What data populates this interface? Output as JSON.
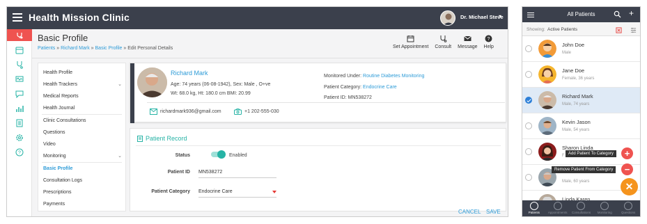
{
  "app": {
    "title": "Health Mission Clinic",
    "doctor": "Dr. Michael Steve"
  },
  "page": {
    "title": "Basic Profile"
  },
  "breadcrumb": [
    "Patients",
    "Richard Mark",
    "Basic Profile",
    "Edit Personal Details"
  ],
  "toolbar": {
    "set_appointment": "Set Appointment",
    "consult": "Consult",
    "message": "Message",
    "help": "Help"
  },
  "menu": {
    "group1": [
      "Health Profile",
      "Health Trackers",
      "Medical Reports",
      "Health Journal"
    ],
    "group2": [
      "Clinic Consultations",
      "Questions",
      "Video",
      "Monitoring"
    ],
    "group3": [
      "Basic Profile",
      "Consultation Logs",
      "Prescriptions",
      "Payments"
    ]
  },
  "patient": {
    "name": "Richard Mark",
    "line1": "Age: 74 years (06-08-1942), Sex: Male , O+ve",
    "line2": "Wt: 68.0 kg, Ht: 180.0 cm BMI: 20.99",
    "monitored_label": "Monitored Under:",
    "monitored_value": "Routine Diabetes Monitoring",
    "category_label": "Patient Category:",
    "category_value": "Endocrine Care",
    "id_label": "Patient ID:",
    "id_value": "MN538272",
    "email": "richardmark936@gmail.com",
    "phone": "+1 202-555-030"
  },
  "record": {
    "title": "Patient Record",
    "status_label": "Status",
    "status_value": "Enabled",
    "status_on": true,
    "id_label": "Patient ID",
    "id_value": "MN538272",
    "category_label": "Patient Category",
    "category_value": "Endocrine Care",
    "cancel": "CANCEL",
    "save": "SAVE"
  },
  "mobile": {
    "title": "All Patients",
    "showing_label": "Showing:",
    "showing_value": "Active Patients",
    "cancel_label": "Cancel",
    "filter_label": "Filter",
    "patients": [
      {
        "name": "John Doe",
        "sub": "Male"
      },
      {
        "name": "Jane Doe",
        "sub": "Female, 36 years"
      },
      {
        "name": "Richard Mark",
        "sub": "Male, 74 years"
      },
      {
        "name": "Kevin Jason",
        "sub": "Male, 54 years"
      },
      {
        "name": "Sharon Linda",
        "sub": "F"
      },
      {
        "name": "",
        "sub": "Male, 60 years"
      },
      {
        "name": "Linda Karen",
        "sub": ""
      }
    ],
    "tip_add": "Add Patient To Category",
    "tip_remove": "Remove Patient From Category",
    "bottom_nav": [
      "Patients",
      "Appointments",
      "Consultations",
      "Monitoring",
      "Questions"
    ]
  },
  "colors": {
    "header": "#3b404c",
    "accent": "#2d9bd7",
    "teal": "#26b3a5",
    "red": "#ef5350",
    "orange": "#f5941e"
  }
}
